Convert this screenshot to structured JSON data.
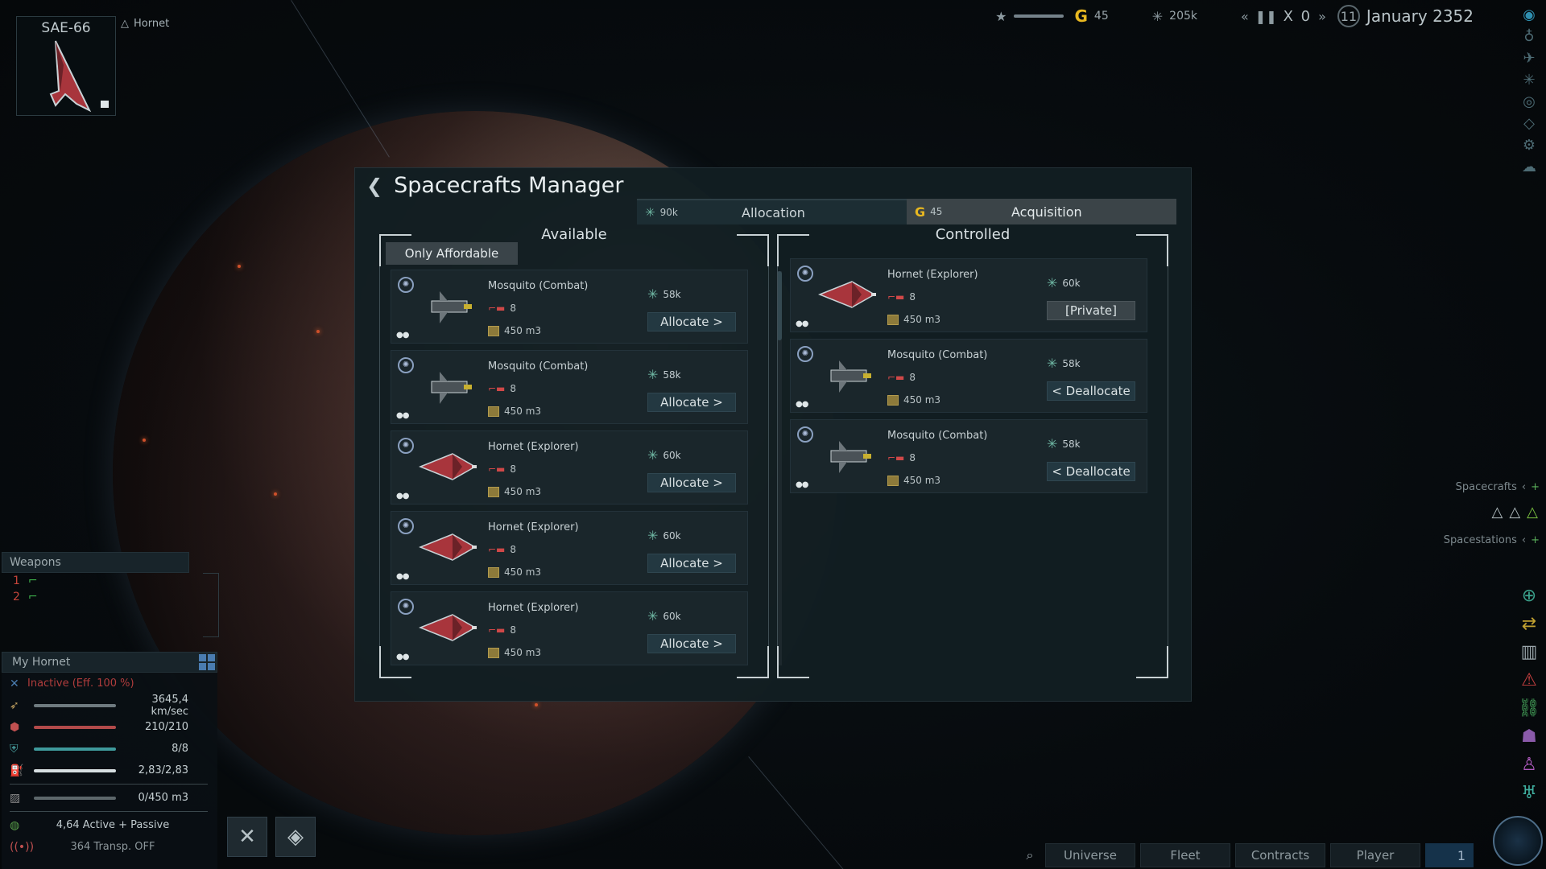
{
  "topbar": {
    "gold_value": "45",
    "credits_value": "205k",
    "speed": "X 0",
    "day": "11",
    "date": "January 2352"
  },
  "ship_card": {
    "name": "SAE-66",
    "class_label": "Hornet"
  },
  "weapons": {
    "title": "Weapons",
    "slots": [
      {
        "num": "1",
        "color": "#c4443a"
      },
      {
        "num": "2",
        "color": "#c4443a"
      }
    ]
  },
  "stats": {
    "title": "My Hornet",
    "status": "Inactive (Eff. 100 %)",
    "speed": "3645,4 km/sec",
    "hull": "210/210",
    "shield": "8/8",
    "fuel": "2,83/2,83",
    "cargo": "0/450  m3",
    "modules": "4,64 Active + Passive",
    "transponder": "364 Transp. OFF"
  },
  "side_lists": {
    "spacecrafts": "Spacecrafts",
    "spacestations": "Spacestations"
  },
  "bottom_nav": {
    "tabs": [
      "Universe",
      "Fleet",
      "Contracts",
      "Player"
    ],
    "num": "1"
  },
  "modal": {
    "title": "Spacecrafts Manager",
    "tab_allocation": {
      "cost": "90k",
      "label": "Allocation"
    },
    "tab_acquisition": {
      "cost": "45",
      "label": "Acquisition"
    },
    "available_heading": "Available",
    "controlled_heading": "Controlled",
    "filter_label": "Only Affordable",
    "available": [
      {
        "name": "Mosquito (Combat)",
        "weapons": "8",
        "cargo": "450 m3",
        "price": "58k",
        "action": "Allocate >",
        "type": "mosquito"
      },
      {
        "name": "Mosquito (Combat)",
        "weapons": "8",
        "cargo": "450 m3",
        "price": "58k",
        "action": "Allocate >",
        "type": "mosquito"
      },
      {
        "name": "Hornet (Explorer)",
        "weapons": "8",
        "cargo": "450 m3",
        "price": "60k",
        "action": "Allocate >",
        "type": "hornet"
      },
      {
        "name": "Hornet (Explorer)",
        "weapons": "8",
        "cargo": "450 m3",
        "price": "60k",
        "action": "Allocate >",
        "type": "hornet"
      },
      {
        "name": "Hornet (Explorer)",
        "weapons": "8",
        "cargo": "450 m3",
        "price": "60k",
        "action": "Allocate >",
        "type": "hornet"
      }
    ],
    "controlled": [
      {
        "name": "Hornet (Explorer)",
        "weapons": "8",
        "cargo": "450 m3",
        "price": "60k",
        "action": "[Private]",
        "type": "hornet"
      },
      {
        "name": "Mosquito (Combat)",
        "weapons": "8",
        "cargo": "450 m3",
        "price": "58k",
        "action": "< Deallocate",
        "type": "mosquito"
      },
      {
        "name": "Mosquito (Combat)",
        "weapons": "8",
        "cargo": "450 m3",
        "price": "58k",
        "action": "< Deallocate",
        "type": "mosquito"
      }
    ]
  },
  "colors": {
    "accent_gold": "#e8b820",
    "danger": "#b03c3c",
    "panel": "#1a262b"
  }
}
